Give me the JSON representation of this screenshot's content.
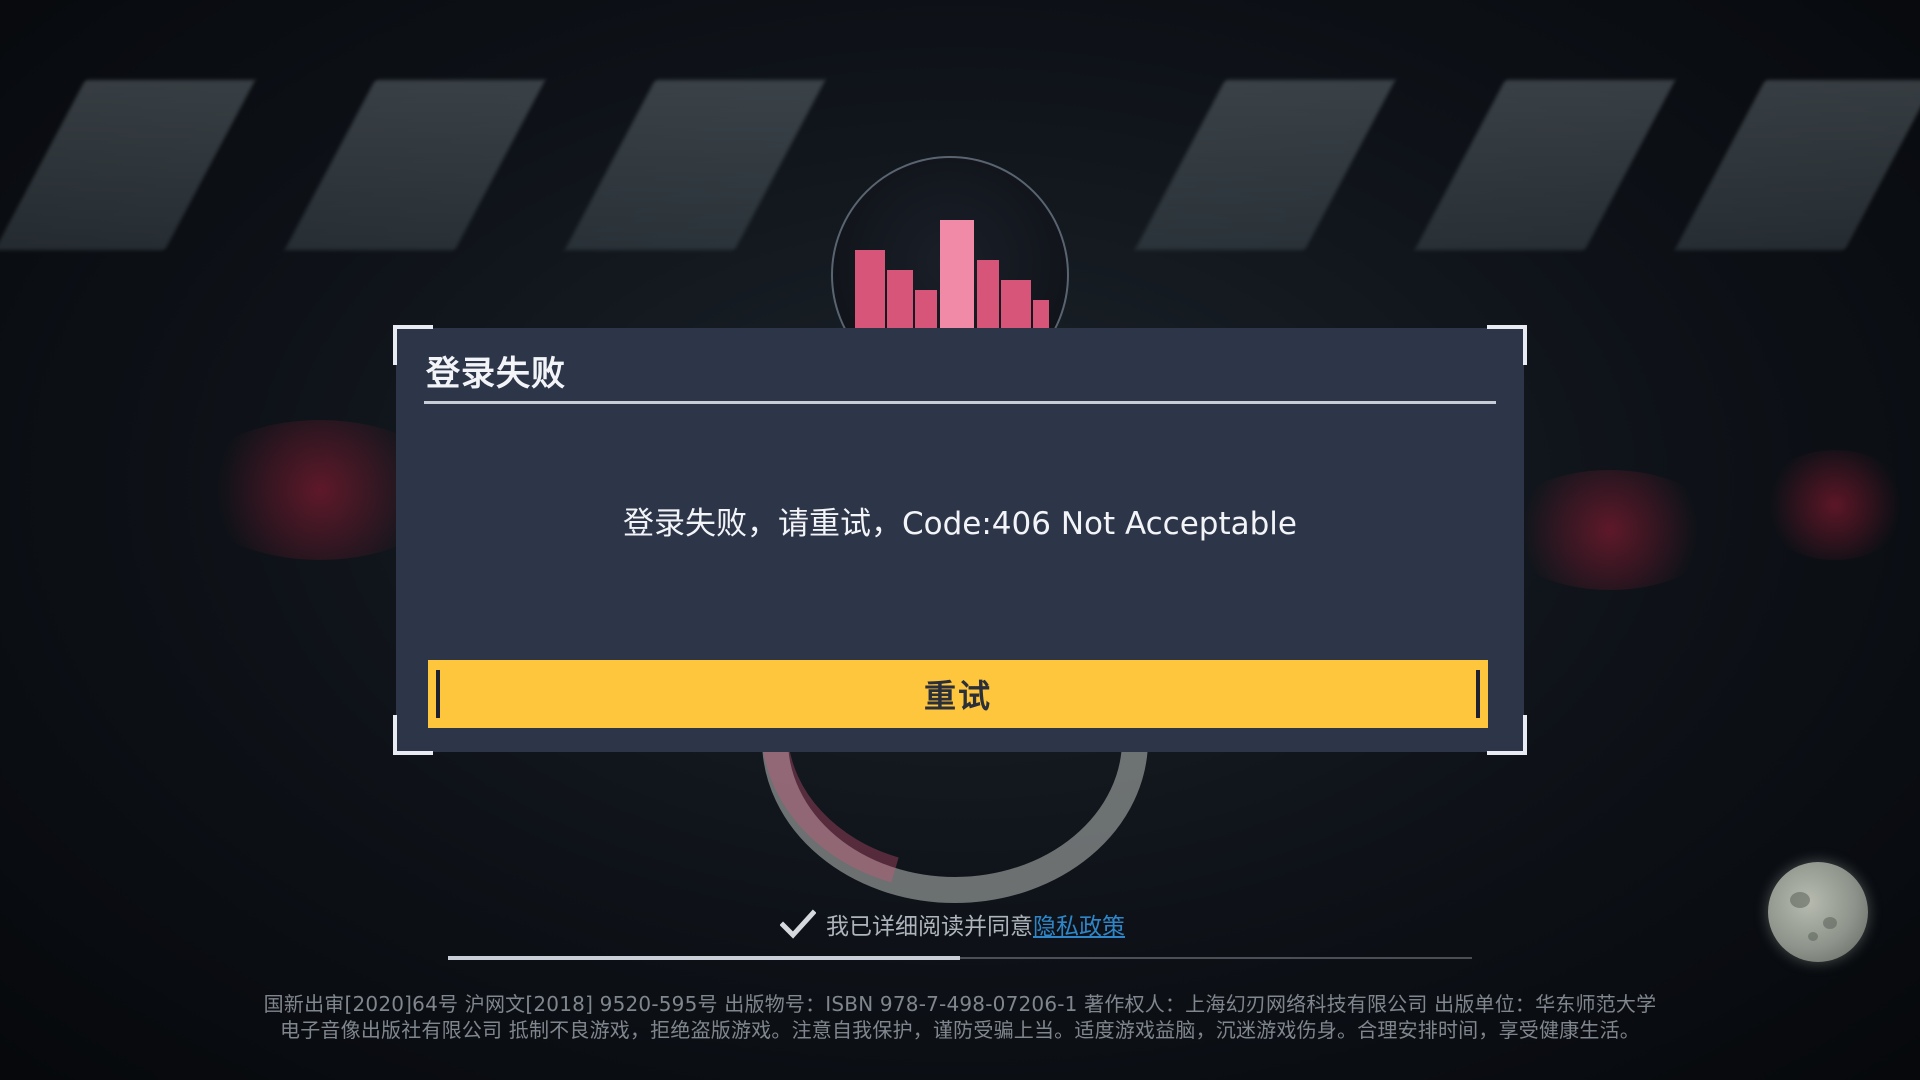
{
  "dialog": {
    "title": "登录失败",
    "message": "登录失败，请重试，Code:406 Not Acceptable",
    "retry_label": "重试"
  },
  "agreement": {
    "checked": true,
    "text": "我已详细阅读并同意",
    "link_label": "隐私政策"
  },
  "loading_progress": 0.5,
  "footer": {
    "line1": "国新出审[2020]64号   沪网文[2018] 9520-595号   出版物号：ISBN 978-7-498-07206-1   著作权人：上海幻刃网络科技有限公司   出版单位：华东师范大学",
    "line2": "电子音像出版社有限公司   抵制不良游戏，拒绝盗版游戏。注意自我保护，谨防受骗上当。适度游戏益脑，沉迷游戏伤身。合理安排时间，享受健康生活。"
  },
  "colors": {
    "dialog_bg": "#2d3549",
    "button_yellow": "#fdc63d",
    "link_blue": "#2e86c9",
    "emblem_pink": "#d8557a"
  },
  "icons": {
    "check": "check-icon",
    "emblem": "city-emblem-icon",
    "moon": "moon-icon"
  }
}
